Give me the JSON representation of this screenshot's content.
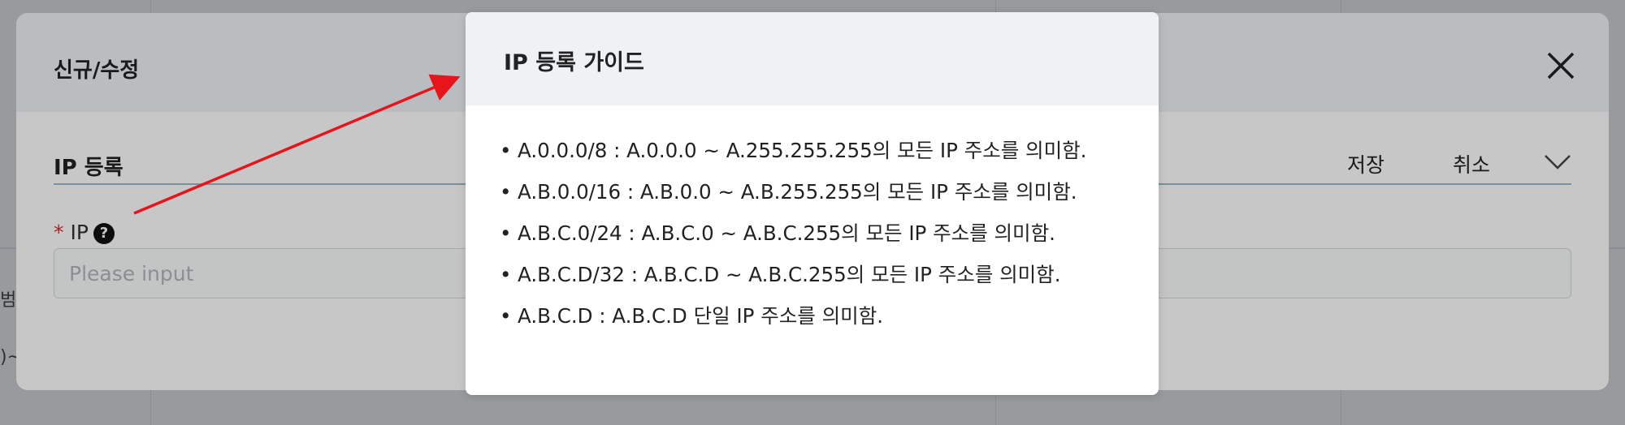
{
  "background": {
    "side_text_1": "범",
    "side_text_2": ")~"
  },
  "modal": {
    "title": "신규/수정",
    "close_icon": "close-icon",
    "section_title": "IP 등록",
    "save_label": "저장",
    "cancel_label": "취소",
    "ip_label": "IP",
    "ip_required_mark": "*",
    "help_icon_glyph": "?",
    "ip_placeholder": "Please input",
    "ip_value": ""
  },
  "guide": {
    "title": "IP 등록 가이드",
    "items": [
      "A.0.0.0/8 : A.0.0.0 ~ A.255.255.255의 모든 IP 주소를 의미함.",
      "A.B.0.0/16 : A.B.0.0 ~ A.B.255.255의 모든 IP 주소를 의미함.",
      "A.B.C.0/24 : A.B.C.0 ~ A.B.C.255의 모든 IP 주소를 의미함.",
      "A.B.C.D/32 : A.B.C.D ~ A.B.C.255의 모든 IP 주소를 의미함.",
      "A.B.C.D : A.B.C.D 단일 IP 주소를 의미함."
    ]
  },
  "colors": {
    "required": "#d0342c",
    "annotation_arrow": "#e8141c",
    "header_bg": "#eef2f5"
  }
}
